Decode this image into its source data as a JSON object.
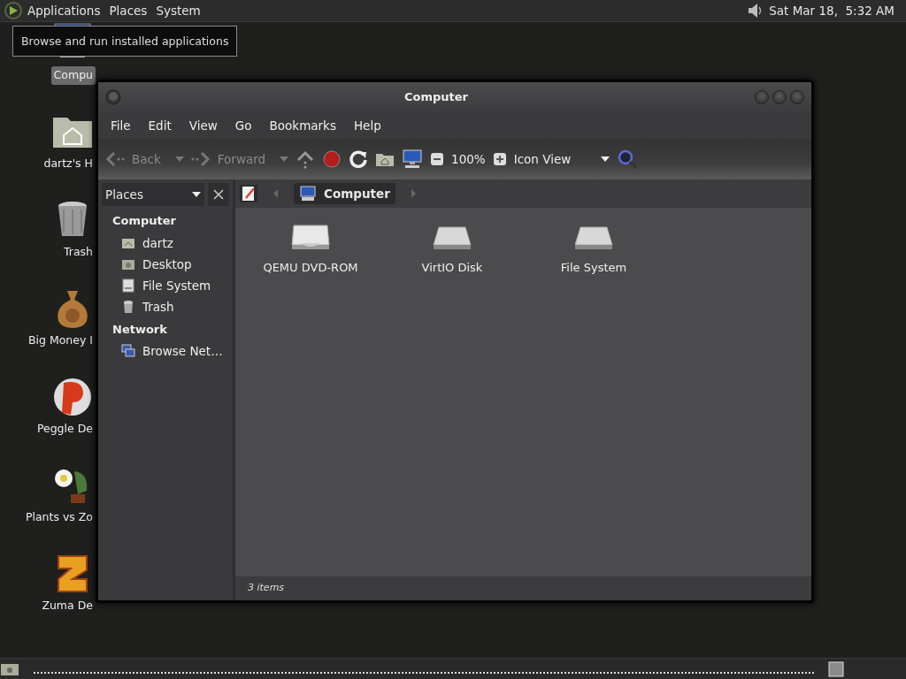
{
  "top_panel": {
    "menus": [
      "Applications",
      "Places",
      "System"
    ],
    "clock": "Sat Mar 18,  5:32 AM"
  },
  "tooltip": "Browse and run installed applications",
  "desktop_icons": [
    {
      "label": "Compu",
      "kind": "computer",
      "selected": true
    },
    {
      "label": "dartz's H",
      "kind": "home",
      "selected": false
    },
    {
      "label": "Trash",
      "kind": "trash",
      "selected": false
    },
    {
      "label": "Big Money I",
      "kind": "bag",
      "selected": false
    },
    {
      "label": "Peggle De",
      "kind": "ball",
      "selected": false
    },
    {
      "label": "Plants vs Zo",
      "kind": "flower",
      "selected": false
    },
    {
      "label": "Zuma De",
      "kind": "block",
      "selected": false
    }
  ],
  "window": {
    "title": "Computer",
    "menu": [
      "File",
      "Edit",
      "View",
      "Go",
      "Bookmarks",
      "Help"
    ],
    "toolbar": {
      "back": {
        "label": "Back",
        "disabled": true
      },
      "forward": {
        "label": "Forward",
        "disabled": true
      },
      "zoom": "100%",
      "view": "Icon View"
    },
    "sidebar": {
      "selector": "Places",
      "sections": [
        {
          "heading": "Computer",
          "items": [
            {
              "label": "dartz",
              "kind": "home"
            },
            {
              "label": "Desktop",
              "kind": "desktop"
            },
            {
              "label": "File System",
              "kind": "drive"
            },
            {
              "label": "Trash",
              "kind": "trash"
            }
          ]
        },
        {
          "heading": "Network",
          "items": [
            {
              "label": "Browse Net…",
              "kind": "network"
            }
          ]
        }
      ]
    },
    "path": [
      {
        "label": "Computer",
        "selected": true
      }
    ],
    "items": [
      {
        "label": "QEMU DVD-ROM",
        "kind": "optical"
      },
      {
        "label": "VirtIO Disk",
        "kind": "disk"
      },
      {
        "label": "File System",
        "kind": "disk"
      }
    ],
    "status": "3 items"
  }
}
